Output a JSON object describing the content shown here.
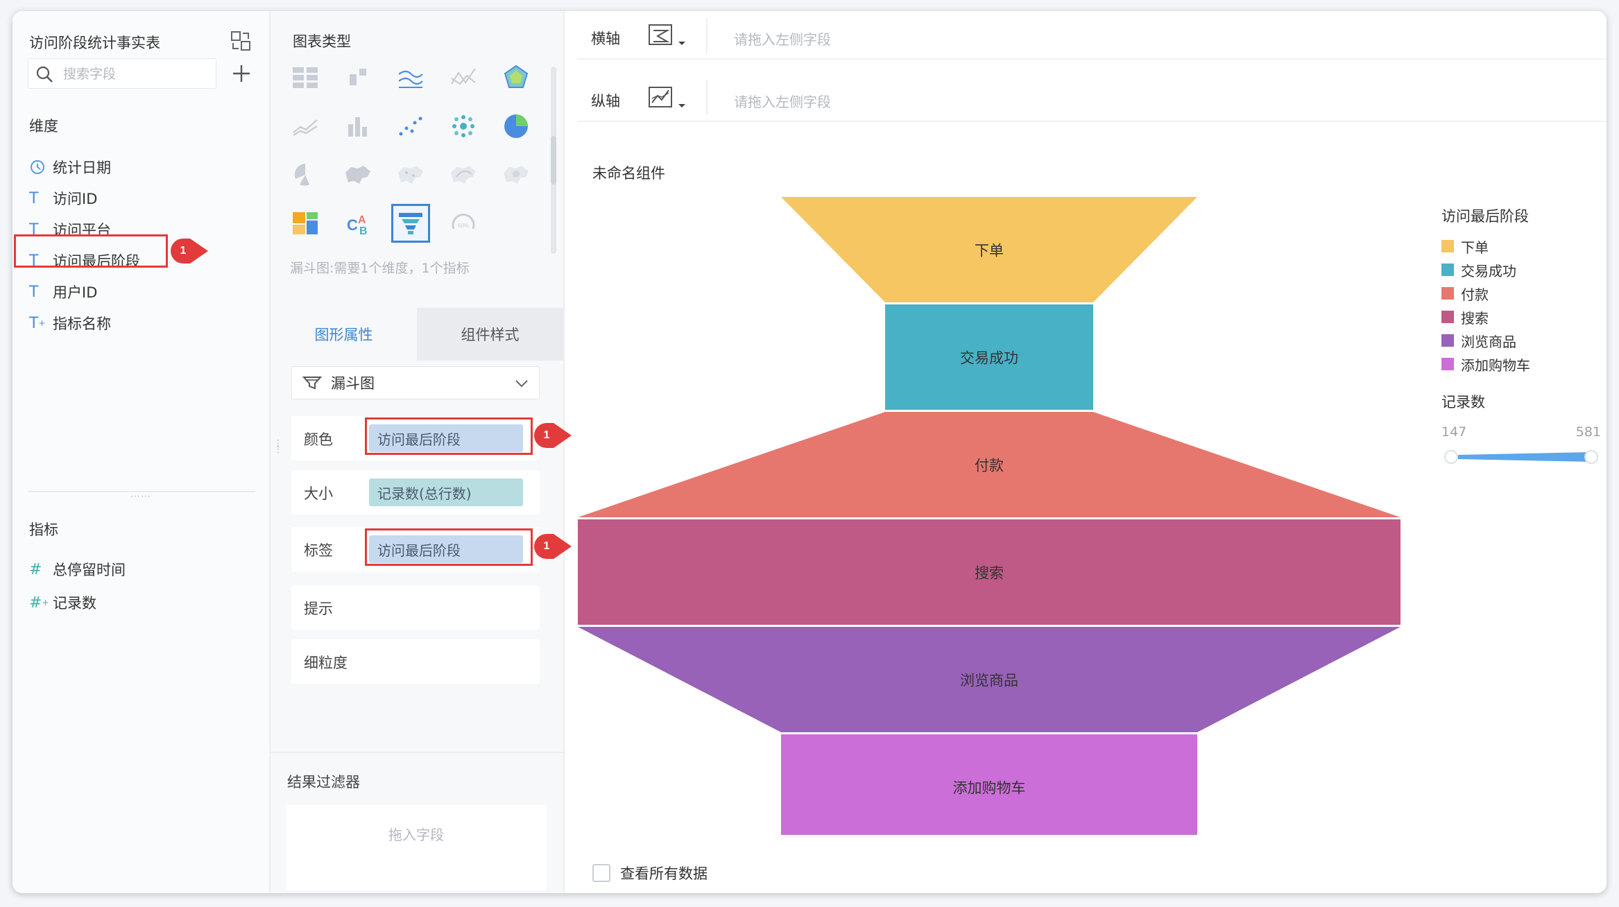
{
  "fields_panel": {
    "table_title": "访问阶段统计事实表",
    "search_placeholder": "搜索字段",
    "dimensions_label": "维度",
    "dimensions": [
      {
        "label": "统计日期",
        "icon": "clock-icon"
      },
      {
        "label": "访问ID",
        "icon": "text-type-icon"
      },
      {
        "label": "访问平台",
        "icon": "text-type-icon"
      },
      {
        "label": "访问最后阶段",
        "icon": "text-type-icon",
        "highlighted": true,
        "marker": "1"
      },
      {
        "label": "用户ID",
        "icon": "text-type-icon"
      },
      {
        "label": "指标名称",
        "icon": "text-type-derived-icon"
      }
    ],
    "measures_label": "指标",
    "measures": [
      {
        "label": "总停留时间",
        "icon": "hash-icon"
      },
      {
        "label": "记录数",
        "icon": "hash-derived-icon"
      }
    ]
  },
  "config_panel": {
    "chart_type_title": "图表类型",
    "chart_type_hint": "漏斗图:需要1个维度，1个指标",
    "tabs": [
      "图形属性",
      "组件样式"
    ],
    "chart_select": "漏斗图",
    "properties": [
      {
        "label": "颜色",
        "value": "访问最后阶段",
        "marker": "1"
      },
      {
        "label": "大小",
        "value": "记录数(总行数)"
      },
      {
        "label": "标签",
        "value": "访问最后阶段",
        "marker": "1"
      },
      {
        "label": "提示",
        "value": ""
      },
      {
        "label": "细粒度",
        "value": ""
      }
    ],
    "filter_title": "结果过滤器",
    "filter_placeholder": "拖入字段"
  },
  "axes": {
    "x_label": "横轴",
    "y_label": "纵轴",
    "placeholder": "请拖入左侧字段"
  },
  "chart": {
    "component_title": "未命名组件",
    "legend_title": "访问最后阶段",
    "size_legend_title": "记录数",
    "size_min": "147",
    "size_max": "581",
    "view_all_label": "查看所有数据"
  },
  "chart_data": {
    "type": "funnel",
    "stages": [
      {
        "name": "下单",
        "color": "#f5c662",
        "top_width": 600,
        "bottom_width": 300
      },
      {
        "name": "交易成功",
        "color": "#48b1c6",
        "top_width": 300,
        "bottom_width": 300
      },
      {
        "name": "付款",
        "color": "#e6776f",
        "top_width": 300,
        "bottom_width": 1186
      },
      {
        "name": "搜索",
        "color": "#be5a85",
        "top_width": 1186,
        "bottom_width": 1186
      },
      {
        "name": "浏览商品",
        "color": "#9862b8",
        "top_width": 1186,
        "bottom_width": 600
      },
      {
        "name": "添加购物车",
        "color": "#cc6ed8",
        "top_width": 600,
        "bottom_width": 600
      }
    ],
    "size_range": [
      147,
      581
    ],
    "legend_placement": "top-right"
  }
}
